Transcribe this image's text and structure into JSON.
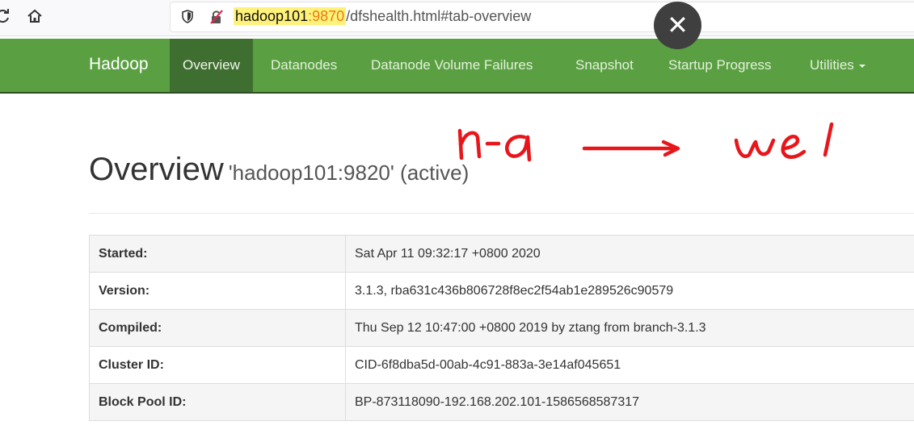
{
  "browser": {
    "url_host": "hadoop101",
    "url_port": ":9870",
    "url_path": "/dfshealth.html#tab-overview"
  },
  "navbar": {
    "brand": "Hadoop",
    "items": [
      {
        "label": "Overview",
        "active": true
      },
      {
        "label": "Datanodes"
      },
      {
        "label": "Datanode Volume Failures"
      },
      {
        "label": "Snapshot"
      },
      {
        "label": "Startup Progress"
      },
      {
        "label": "Utilities"
      }
    ]
  },
  "overview": {
    "title": "Overview",
    "subtitle": "'hadoop101:9820' (active)"
  },
  "info_table": [
    {
      "key": "Started:",
      "value": "Sat Apr 11 09:32:17 +0800 2020"
    },
    {
      "key": "Version:",
      "value": "3.1.3, rba631c436b806728f8ec2f54ab1e289526c90579"
    },
    {
      "key": "Compiled:",
      "value": "Thu Sep 12 10:47:00 +0800 2019 by ztang from branch-3.1.3"
    },
    {
      "key": "Cluster ID:",
      "value": "CID-6f8dba5d-00ab-4c91-883a-3e14af045651"
    },
    {
      "key": "Block Pool ID:",
      "value": "BP-873118090-192.168.202.101-1586568587317"
    }
  ],
  "colors": {
    "navbar": "#5aa042",
    "navbar_active": "#3f6f30",
    "annotation": "#e8161b"
  },
  "icons": [
    "reload-icon",
    "home-icon",
    "shield-icon",
    "insecure-lock-icon",
    "close-icon",
    "caret-down-icon"
  ]
}
